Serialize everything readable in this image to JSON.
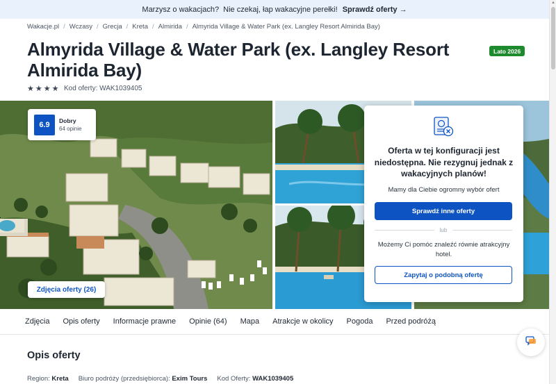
{
  "promo": {
    "text": "Marzysz o wakacjach?  Nie czekaj, łap wakacyjne perełki! ",
    "cta": "Sprawdź oferty →"
  },
  "breadcrumb": [
    "Wakacje.pl",
    "Wczasy",
    "Grecja",
    "Kreta",
    "Almirida",
    "Almyrida Village & Water Park (ex. Langley Resort Almirida Bay)"
  ],
  "hotel": {
    "title": "Almyrida Village & Water Park (ex. Langley Resort Almirida Bay)",
    "season_badge": "Lato 2026",
    "stars": 4,
    "offer_code": "Kod oferty: WAK1039405"
  },
  "rating": {
    "score": "6.9",
    "word": "Dobry",
    "count": "64 opinie"
  },
  "gallery": {
    "photos_button": "Zdjęcia oferty (26)"
  },
  "unavailable": {
    "title": "Oferta w tej konfiguracji jest niedostępna. Nie rezygnuj jednak z wakacyjnych planów!",
    "subtitle": "Mamy dla Ciebie ogromny wybór ofert",
    "primary_button": "Sprawdź inne oferty",
    "or": "lub",
    "help_text": "Możemy Ci pomóc znaleźć równie atrakcyjny hotel.",
    "secondary_button": "Zapytaj o podobną ofertę"
  },
  "tabs": [
    "Zdjęcia",
    "Opis oferty",
    "Informacje prawne",
    "Opinie (64)",
    "Mapa",
    "Atrakcje w okolicy",
    "Pogoda",
    "Przed podróżą"
  ],
  "description": {
    "title": "Opis oferty",
    "region_label": "Region:",
    "region_value": "Kreta",
    "agency_label": "Biuro podróży (przedsiębiorca):",
    "agency_value": "Exim Tours",
    "code_label": "Kod Oferty:",
    "code_value": "WAK1039405"
  },
  "colors": {
    "primary": "#0d54c2",
    "badge_green": "#1e8a2e",
    "promo_bg": "#e8f1fc"
  }
}
